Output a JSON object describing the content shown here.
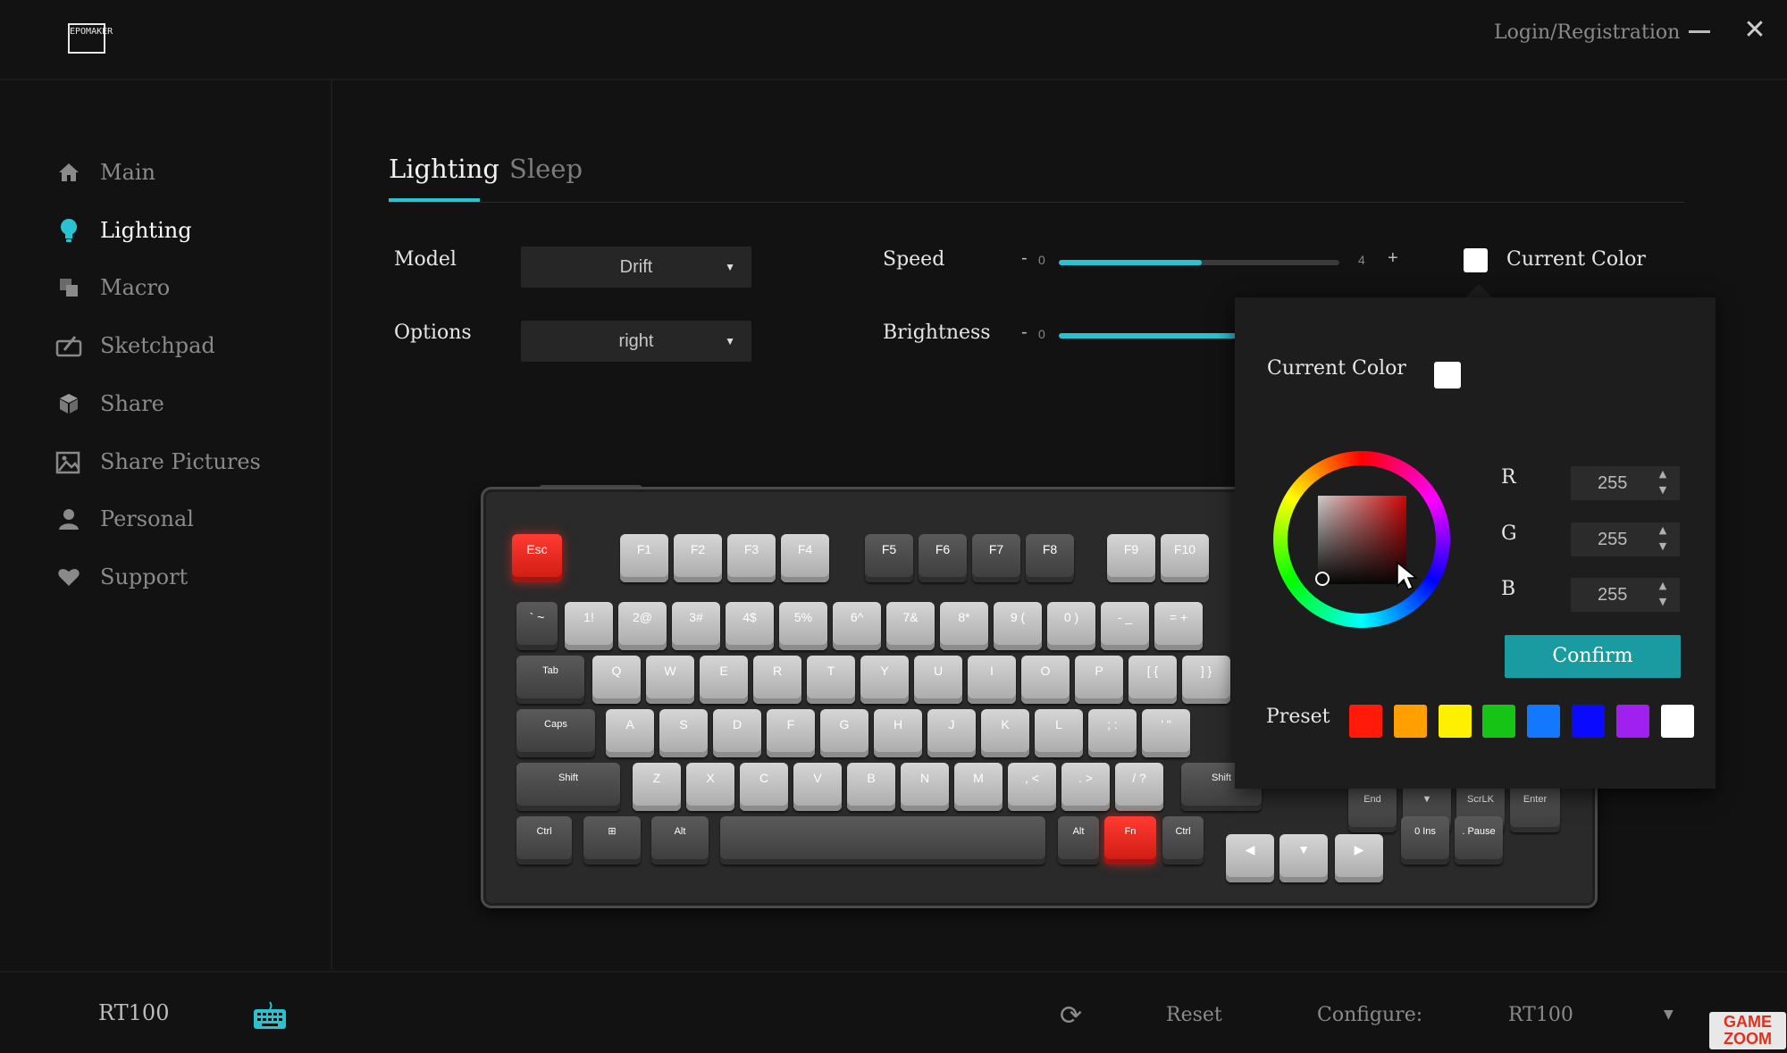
{
  "header": {
    "logo_text": "EPOMAKER",
    "login_label": "Login/Registration"
  },
  "sidebar": {
    "items": [
      {
        "label": "Main",
        "icon": "home-icon"
      },
      {
        "label": "Lighting",
        "icon": "lightbulb-icon",
        "active": true
      },
      {
        "label": "Macro",
        "icon": "macro-icon"
      },
      {
        "label": "Sketchpad",
        "icon": "sketchpad-icon"
      },
      {
        "label": "Share",
        "icon": "cube-icon"
      },
      {
        "label": "Share Pictures",
        "icon": "picture-icon"
      },
      {
        "label": "Personal",
        "icon": "person-icon"
      },
      {
        "label": "Support",
        "icon": "heart-icon"
      }
    ]
  },
  "tabs": [
    {
      "label": "Lighting",
      "active": true
    },
    {
      "label": "Sleep"
    }
  ],
  "controls": {
    "model_label": "Model",
    "model_value": "Drift",
    "options_label": "Options",
    "options_value": "right",
    "speed_label": "Speed",
    "speed_min": "0",
    "speed_max": "4",
    "speed_fill": 0.51,
    "brightness_label": "Brightness",
    "brightness_min": "0",
    "current_color_label": "Current Color",
    "current_color": "#ffffff",
    "accent": "#28c3cf"
  },
  "color_picker": {
    "current_color_label": "Current Color",
    "r_label": "R",
    "r_value": "255",
    "g_label": "G",
    "g_value": "255",
    "b_label": "B",
    "b_value": "255",
    "confirm_label": "Confirm",
    "preset_label": "Preset",
    "presets": [
      "#ff1a0a",
      "#ffa000",
      "#ffef00",
      "#16c416",
      "#1478ff",
      "#0a0aff",
      "#a020f0",
      "#ffffff"
    ]
  },
  "keyboard": {
    "function_row": [
      "Esc",
      "F1",
      "F2",
      "F3",
      "F4",
      "F5",
      "F6",
      "F7",
      "F8",
      "F9",
      "F10"
    ],
    "number_row": [
      "` ~",
      "1!",
      "2@",
      "3#",
      "4$",
      "5%",
      "6^",
      "7&",
      "8*",
      "9 (",
      "0 )",
      "- _",
      "= +"
    ],
    "qwerty_row": [
      "Tab",
      "Q",
      "W",
      "E",
      "R",
      "T",
      "Y",
      "U",
      "I",
      "O",
      "P",
      "[ {",
      "] }"
    ],
    "home_row": [
      "Caps",
      "A",
      "S",
      "D",
      "F",
      "G",
      "H",
      "J",
      "K",
      "L",
      "; :",
      "' \""
    ],
    "shift_row": [
      "Shift",
      "Z",
      "X",
      "C",
      "V",
      "B",
      "N",
      "M",
      ", <",
      ". >",
      "/ ?",
      "Shift"
    ],
    "bottom_row": [
      "Ctrl",
      "⊞",
      "Alt",
      "",
      "Alt",
      "Fn",
      "Ctrl"
    ],
    "nav_keys": [
      "End",
      "▼",
      "ScrLK",
      "Enter",
      "0 Ins",
      ". Pause",
      "◀",
      "▼",
      "▶"
    ]
  },
  "footer": {
    "model_name": "RT100",
    "reset_label": "Reset",
    "configure_label": "Configure:",
    "configure_value": "RT100",
    "watermark": "GAME ZOOM"
  }
}
